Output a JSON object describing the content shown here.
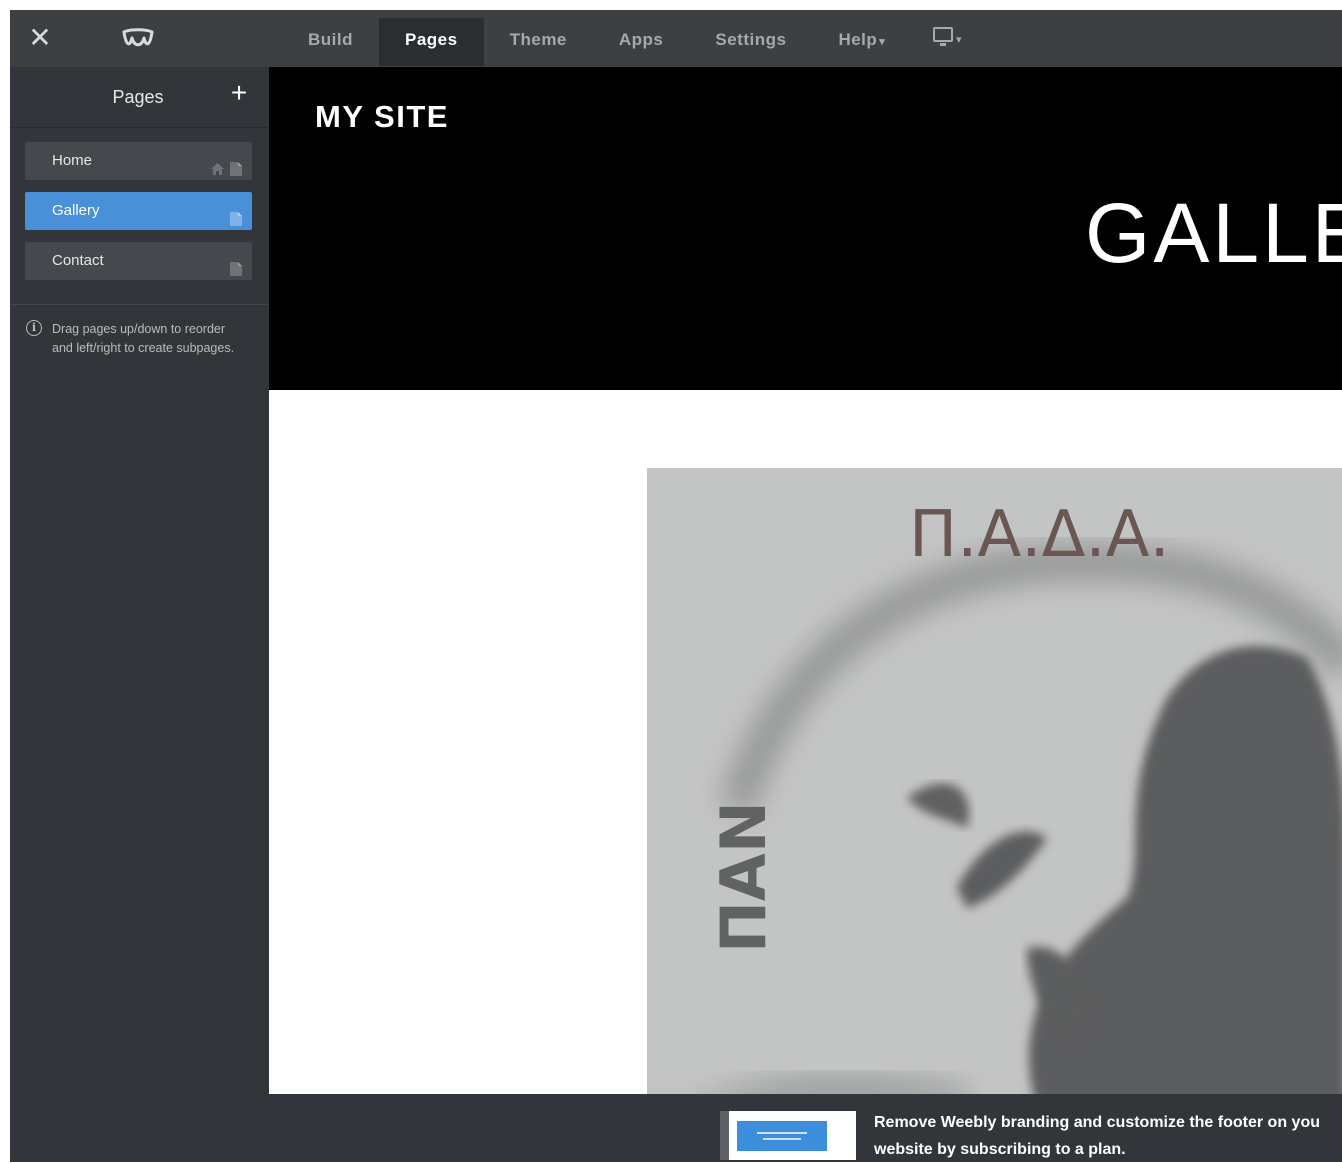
{
  "topbar": {
    "nav": [
      {
        "label": "Build"
      },
      {
        "label": "Pages"
      },
      {
        "label": "Theme"
      },
      {
        "label": "Apps"
      },
      {
        "label": "Settings"
      },
      {
        "label": "Help"
      }
    ],
    "close_icon": "close-icon",
    "logo_icon": "weebly-logo-icon",
    "device_icon": "desktop-monitor-icon"
  },
  "sidebar": {
    "title": "Pages",
    "pages": [
      {
        "label": "Home",
        "icons": [
          "home-icon",
          "page-icon"
        ]
      },
      {
        "label": "Gallery",
        "icons": [
          "page-icon"
        ]
      },
      {
        "label": "Contact",
        "icons": [
          "page-icon"
        ]
      }
    ],
    "info_line1": "Drag pages up/down to reorder",
    "info_line2": "and left/right to create subpages."
  },
  "site": {
    "title": "MY SITE",
    "hero": "GALLE",
    "image_caption": "Π.Α.Δ.Α.",
    "image_side_text": "ΠΑΝ"
  },
  "footer": {
    "line1": "Remove Weebly branding and customize the footer on you",
    "line2": "website by subscribing to a plan."
  },
  "colors": {
    "topbar": "#3c4043",
    "sidebar": "#32363a",
    "accent": "#4a90d9",
    "header_bg": "#000000"
  }
}
